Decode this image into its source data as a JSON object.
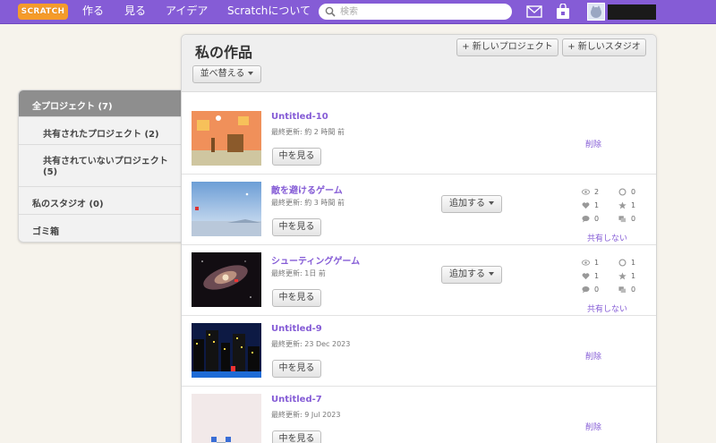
{
  "nav": {
    "logo": "SCRATCH",
    "links": [
      "作る",
      "見る",
      "アイデア",
      "Scratchについて"
    ],
    "search_placeholder": "検索"
  },
  "sidebar": {
    "items": [
      {
        "label": "全プロジェクト (7)"
      },
      {
        "label": "共有されたプロジェクト (2)"
      },
      {
        "label_line1": "共有されていないプロジェクト",
        "label_line2": "(5)"
      },
      {
        "label": "私のスタジオ (0)"
      },
      {
        "label": "ゴミ箱"
      }
    ]
  },
  "main": {
    "title": "私の作品",
    "new_project": "+ 新しいプロジェクト",
    "new_studio": "+ 新しいスタジオ",
    "sort_label": "並べ替える"
  },
  "projects": [
    {
      "title": "Untitled-10",
      "updated": "最終更新: 約 2 時間 前",
      "open": "中を見る",
      "delete": "削除"
    },
    {
      "title": "敵を避けるゲーム",
      "updated": "最終更新: 約 3 時間 前",
      "open": "中を見る",
      "add": "追加する",
      "views": "2",
      "remixes": "0",
      "loves": "1",
      "favorites": "1",
      "comments": "0",
      "studios": "0",
      "unshare": "共有しない"
    },
    {
      "title": "シューティングゲーム",
      "updated": "最終更新: 1日 前",
      "open": "中を見る",
      "add": "追加する",
      "views": "1",
      "remixes": "1",
      "loves": "1",
      "favorites": "1",
      "comments": "0",
      "studios": "0",
      "unshare": "共有しない"
    },
    {
      "title": "Untitled-9",
      "updated": "最終更新: 23 Dec 2023",
      "open": "中を見る",
      "delete": "削除"
    },
    {
      "title": "Untitled-7",
      "updated": "最終更新: 9 Jul 2023",
      "open": "中を見る",
      "delete": "削除"
    }
  ],
  "colors": {
    "brand": "#855cd6",
    "logo": "#f59b2a",
    "background": "#f6f3ec"
  }
}
